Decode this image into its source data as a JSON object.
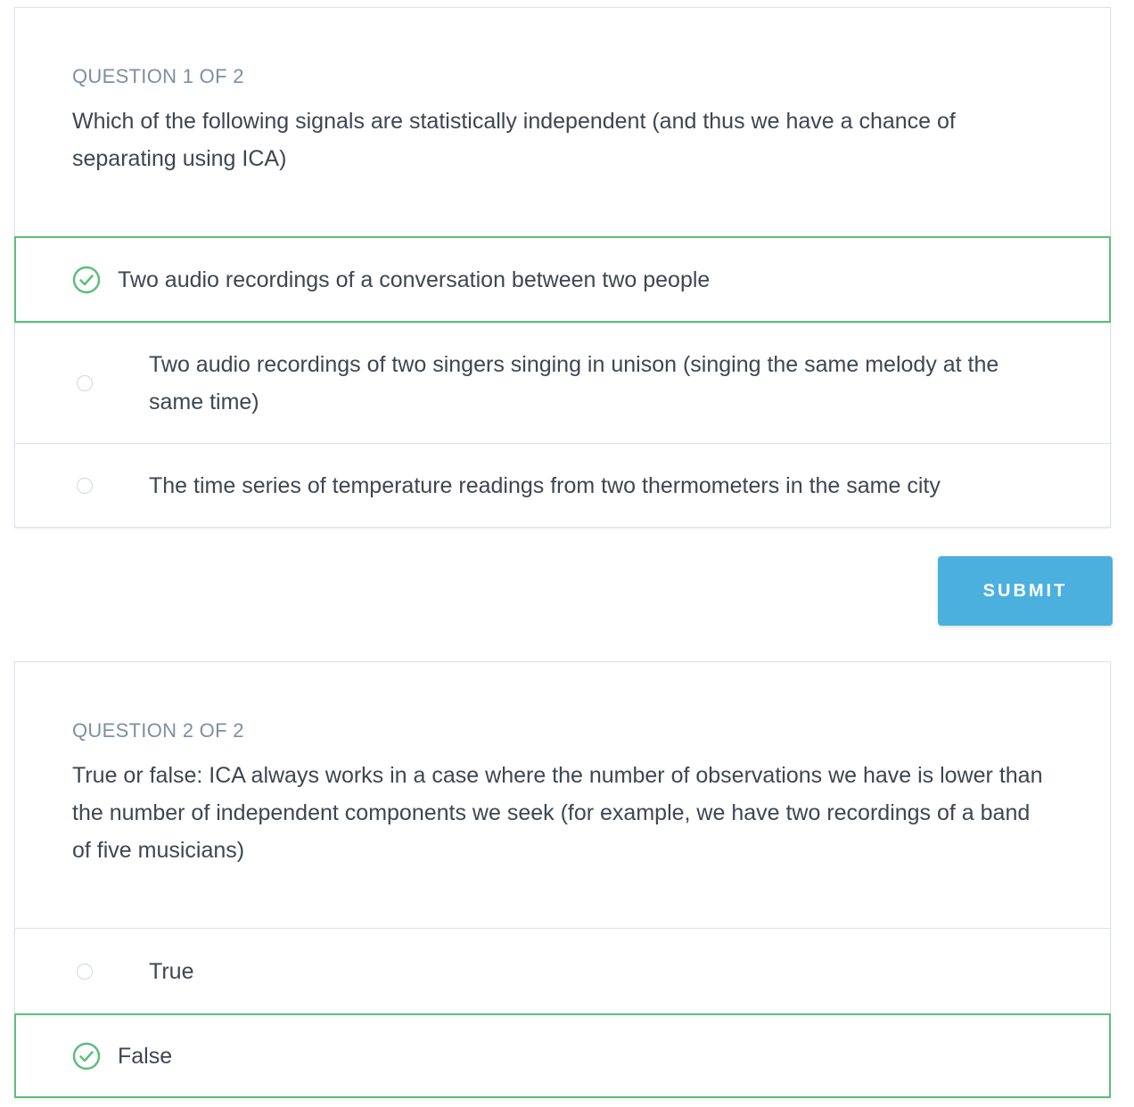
{
  "question1": {
    "label": "QUESTION 1 OF 2",
    "text": "Which of the following signals are statistically independent (and thus we have a chance of separating using ICA)",
    "options": [
      {
        "text": "Two audio recordings of a conversation between two people",
        "selected": true
      },
      {
        "text": "Two audio recordings of two singers singing in unison (singing the same melody at the same time)",
        "selected": false
      },
      {
        "text": "The time series of temperature readings from two thermometers in the same city",
        "selected": false
      }
    ]
  },
  "submit": {
    "label": "SUBMIT"
  },
  "question2": {
    "label": "QUESTION 2 OF 2",
    "text": "True or false: ICA always works in a case where the number of observations we have is lower than the number of independent components we seek (for example, we have two recordings of a band of five musicians)",
    "options": [
      {
        "text": "True",
        "selected": false
      },
      {
        "text": "False",
        "selected": true
      }
    ]
  },
  "colors": {
    "accent_green": "#5ebe7a",
    "submit_blue": "#4cb0df",
    "label_gray": "#7d8fa2",
    "border": "#dbe2e8"
  },
  "icons": {
    "selected": "check-circle-icon",
    "unselected": "radio-empty-icon"
  }
}
